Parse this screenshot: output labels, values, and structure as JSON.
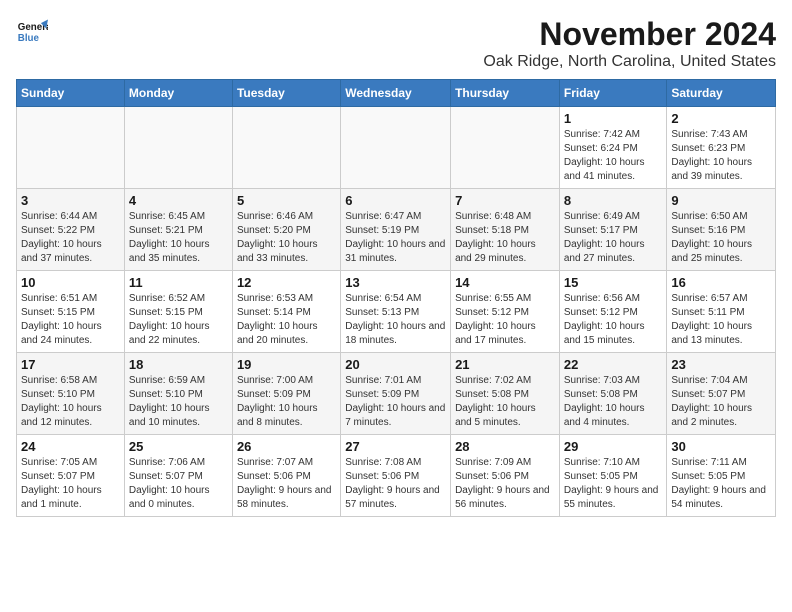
{
  "header": {
    "logo_line1": "General",
    "logo_line2": "Blue",
    "month": "November 2024",
    "location": "Oak Ridge, North Carolina, United States"
  },
  "days_of_week": [
    "Sunday",
    "Monday",
    "Tuesday",
    "Wednesday",
    "Thursday",
    "Friday",
    "Saturday"
  ],
  "weeks": [
    {
      "days": [
        {
          "number": "",
          "empty": true
        },
        {
          "number": "",
          "empty": true
        },
        {
          "number": "",
          "empty": true
        },
        {
          "number": "",
          "empty": true
        },
        {
          "number": "",
          "empty": true
        },
        {
          "number": "1",
          "sunrise": "Sunrise: 7:42 AM",
          "sunset": "Sunset: 6:24 PM",
          "daylight": "Daylight: 10 hours and 41 minutes."
        },
        {
          "number": "2",
          "sunrise": "Sunrise: 7:43 AM",
          "sunset": "Sunset: 6:23 PM",
          "daylight": "Daylight: 10 hours and 39 minutes."
        }
      ]
    },
    {
      "days": [
        {
          "number": "3",
          "sunrise": "Sunrise: 6:44 AM",
          "sunset": "Sunset: 5:22 PM",
          "daylight": "Daylight: 10 hours and 37 minutes."
        },
        {
          "number": "4",
          "sunrise": "Sunrise: 6:45 AM",
          "sunset": "Sunset: 5:21 PM",
          "daylight": "Daylight: 10 hours and 35 minutes."
        },
        {
          "number": "5",
          "sunrise": "Sunrise: 6:46 AM",
          "sunset": "Sunset: 5:20 PM",
          "daylight": "Daylight: 10 hours and 33 minutes."
        },
        {
          "number": "6",
          "sunrise": "Sunrise: 6:47 AM",
          "sunset": "Sunset: 5:19 PM",
          "daylight": "Daylight: 10 hours and 31 minutes."
        },
        {
          "number": "7",
          "sunrise": "Sunrise: 6:48 AM",
          "sunset": "Sunset: 5:18 PM",
          "daylight": "Daylight: 10 hours and 29 minutes."
        },
        {
          "number": "8",
          "sunrise": "Sunrise: 6:49 AM",
          "sunset": "Sunset: 5:17 PM",
          "daylight": "Daylight: 10 hours and 27 minutes."
        },
        {
          "number": "9",
          "sunrise": "Sunrise: 6:50 AM",
          "sunset": "Sunset: 5:16 PM",
          "daylight": "Daylight: 10 hours and 25 minutes."
        }
      ]
    },
    {
      "days": [
        {
          "number": "10",
          "sunrise": "Sunrise: 6:51 AM",
          "sunset": "Sunset: 5:15 PM",
          "daylight": "Daylight: 10 hours and 24 minutes."
        },
        {
          "number": "11",
          "sunrise": "Sunrise: 6:52 AM",
          "sunset": "Sunset: 5:15 PM",
          "daylight": "Daylight: 10 hours and 22 minutes."
        },
        {
          "number": "12",
          "sunrise": "Sunrise: 6:53 AM",
          "sunset": "Sunset: 5:14 PM",
          "daylight": "Daylight: 10 hours and 20 minutes."
        },
        {
          "number": "13",
          "sunrise": "Sunrise: 6:54 AM",
          "sunset": "Sunset: 5:13 PM",
          "daylight": "Daylight: 10 hours and 18 minutes."
        },
        {
          "number": "14",
          "sunrise": "Sunrise: 6:55 AM",
          "sunset": "Sunset: 5:12 PM",
          "daylight": "Daylight: 10 hours and 17 minutes."
        },
        {
          "number": "15",
          "sunrise": "Sunrise: 6:56 AM",
          "sunset": "Sunset: 5:12 PM",
          "daylight": "Daylight: 10 hours and 15 minutes."
        },
        {
          "number": "16",
          "sunrise": "Sunrise: 6:57 AM",
          "sunset": "Sunset: 5:11 PM",
          "daylight": "Daylight: 10 hours and 13 minutes."
        }
      ]
    },
    {
      "days": [
        {
          "number": "17",
          "sunrise": "Sunrise: 6:58 AM",
          "sunset": "Sunset: 5:10 PM",
          "daylight": "Daylight: 10 hours and 12 minutes."
        },
        {
          "number": "18",
          "sunrise": "Sunrise: 6:59 AM",
          "sunset": "Sunset: 5:10 PM",
          "daylight": "Daylight: 10 hours and 10 minutes."
        },
        {
          "number": "19",
          "sunrise": "Sunrise: 7:00 AM",
          "sunset": "Sunset: 5:09 PM",
          "daylight": "Daylight: 10 hours and 8 minutes."
        },
        {
          "number": "20",
          "sunrise": "Sunrise: 7:01 AM",
          "sunset": "Sunset: 5:09 PM",
          "daylight": "Daylight: 10 hours and 7 minutes."
        },
        {
          "number": "21",
          "sunrise": "Sunrise: 7:02 AM",
          "sunset": "Sunset: 5:08 PM",
          "daylight": "Daylight: 10 hours and 5 minutes."
        },
        {
          "number": "22",
          "sunrise": "Sunrise: 7:03 AM",
          "sunset": "Sunset: 5:08 PM",
          "daylight": "Daylight: 10 hours and 4 minutes."
        },
        {
          "number": "23",
          "sunrise": "Sunrise: 7:04 AM",
          "sunset": "Sunset: 5:07 PM",
          "daylight": "Daylight: 10 hours and 2 minutes."
        }
      ]
    },
    {
      "days": [
        {
          "number": "24",
          "sunrise": "Sunrise: 7:05 AM",
          "sunset": "Sunset: 5:07 PM",
          "daylight": "Daylight: 10 hours and 1 minute."
        },
        {
          "number": "25",
          "sunrise": "Sunrise: 7:06 AM",
          "sunset": "Sunset: 5:07 PM",
          "daylight": "Daylight: 10 hours and 0 minutes."
        },
        {
          "number": "26",
          "sunrise": "Sunrise: 7:07 AM",
          "sunset": "Sunset: 5:06 PM",
          "daylight": "Daylight: 9 hours and 58 minutes."
        },
        {
          "number": "27",
          "sunrise": "Sunrise: 7:08 AM",
          "sunset": "Sunset: 5:06 PM",
          "daylight": "Daylight: 9 hours and 57 minutes."
        },
        {
          "number": "28",
          "sunrise": "Sunrise: 7:09 AM",
          "sunset": "Sunset: 5:06 PM",
          "daylight": "Daylight: 9 hours and 56 minutes."
        },
        {
          "number": "29",
          "sunrise": "Sunrise: 7:10 AM",
          "sunset": "Sunset: 5:05 PM",
          "daylight": "Daylight: 9 hours and 55 minutes."
        },
        {
          "number": "30",
          "sunrise": "Sunrise: 7:11 AM",
          "sunset": "Sunset: 5:05 PM",
          "daylight": "Daylight: 9 hours and 54 minutes."
        }
      ]
    }
  ]
}
